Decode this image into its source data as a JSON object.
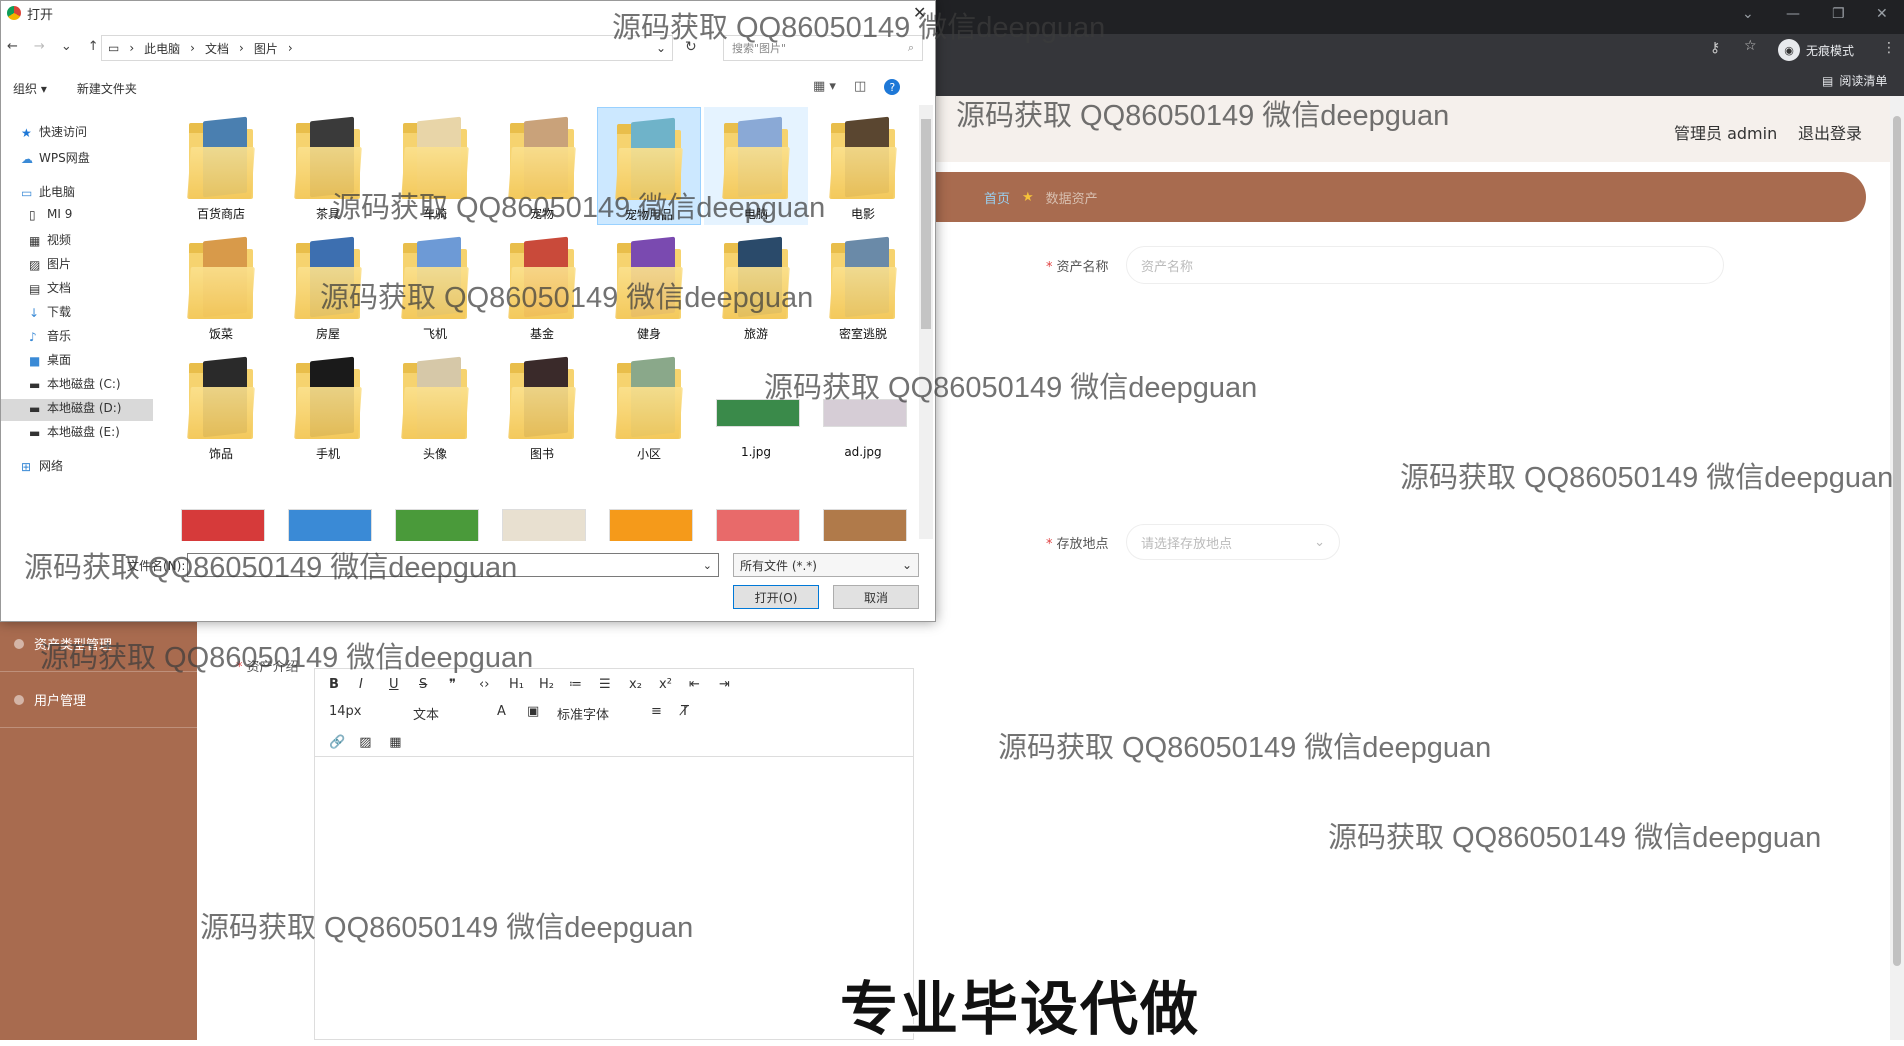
{
  "browser": {
    "profile_label": "无痕模式",
    "reading_list": "阅读清单"
  },
  "app": {
    "admin_label": "管理员 admin",
    "logout_label": "退出登录",
    "breadcrumb": {
      "home": "首页",
      "current": "数据资产"
    },
    "sidebar": {
      "items": [
        {
          "label": "资产类型管理"
        },
        {
          "label": "用户管理"
        }
      ]
    },
    "form": {
      "name_label": "资产名称",
      "name_placeholder": "资产名称",
      "location_label": "存放地点",
      "location_placeholder": "请选择存放地点",
      "intro_label": "资产介绍"
    },
    "editor": {
      "font_size": "14px",
      "text_type": "文本",
      "font_family": "标准字体"
    }
  },
  "dialog": {
    "title": "打开",
    "address": [
      "此电脑",
      "文档",
      "图片"
    ],
    "search_placeholder": "搜索\"图片\"",
    "organize_label": "组织 ▾",
    "new_folder_label": "新建文件夹",
    "nav": [
      {
        "label": "快速访问",
        "icon": "star-icon"
      },
      {
        "label": "WPS网盘",
        "icon": "cloud-icon"
      },
      {
        "label": "此电脑",
        "icon": "computer-icon"
      },
      {
        "label": "MI 9",
        "icon": "phone-icon"
      },
      {
        "label": "视频",
        "icon": "video-icon"
      },
      {
        "label": "图片",
        "icon": "picture-icon"
      },
      {
        "label": "文档",
        "icon": "document-icon"
      },
      {
        "label": "下载",
        "icon": "download-icon"
      },
      {
        "label": "音乐",
        "icon": "music-icon"
      },
      {
        "label": "桌面",
        "icon": "desktop-icon"
      },
      {
        "label": "本地磁盘 (C:)",
        "icon": "disk-icon"
      },
      {
        "label": "本地磁盘 (D:)",
        "icon": "disk-icon"
      },
      {
        "label": "本地磁盘 (E:)",
        "icon": "disk-icon"
      },
      {
        "label": "网络",
        "icon": "network-icon"
      }
    ],
    "files": [
      {
        "name": "百货商店",
        "kind": "folder",
        "color": "#4a7fb0"
      },
      {
        "name": "茶具",
        "kind": "folder",
        "color": "#3a3a3a"
      },
      {
        "name": "车骑",
        "kind": "folder",
        "color": "#e8d5a8"
      },
      {
        "name": "宠物",
        "kind": "folder",
        "color": "#c9a27a"
      },
      {
        "name": "宠物用品",
        "kind": "folder",
        "color": "#6fb3c9"
      },
      {
        "name": "电脑",
        "kind": "folder",
        "color": "#8aa9d6"
      },
      {
        "name": "电影",
        "kind": "folder",
        "color": "#5a4630"
      },
      {
        "name": "饭菜",
        "kind": "folder",
        "color": "#d89a4a"
      },
      {
        "name": "房屋",
        "kind": "folder",
        "color": "#3d6fb0"
      },
      {
        "name": "飞机",
        "kind": "folder",
        "color": "#6d9ad6"
      },
      {
        "name": "基金",
        "kind": "folder",
        "color": "#c94a3a"
      },
      {
        "name": "健身",
        "kind": "folder",
        "color": "#7a4ab0"
      },
      {
        "name": "旅游",
        "kind": "folder",
        "color": "#2a4a6a"
      },
      {
        "name": "密室逃脱",
        "kind": "folder",
        "color": "#6a8aa8"
      },
      {
        "name": "饰品",
        "kind": "folder",
        "color": "#2a2a2a"
      },
      {
        "name": "手机",
        "kind": "folder",
        "color": "#1a1a1a"
      },
      {
        "name": "头像",
        "kind": "folder",
        "color": "#d6c8a8"
      },
      {
        "name": "图书",
        "kind": "folder",
        "color": "#3a2a2a"
      },
      {
        "name": "小区",
        "kind": "folder",
        "color": "#8aa88a"
      },
      {
        "name": "1.jpg",
        "kind": "image",
        "color": "#3a8a4a"
      },
      {
        "name": "ad.jpg",
        "kind": "image",
        "color": "#d6cdd6"
      },
      {
        "name": "",
        "kind": "image",
        "color": "#d63a3a"
      },
      {
        "name": "",
        "kind": "image",
        "color": "#3a8ad6"
      },
      {
        "name": "",
        "kind": "image",
        "color": "#4a9a3a"
      },
      {
        "name": "",
        "kind": "image",
        "color": "#e8e0d0"
      },
      {
        "name": "",
        "kind": "image",
        "color": "#f59a1a"
      },
      {
        "name": "",
        "kind": "image",
        "color": "#e86a6a"
      },
      {
        "name": "",
        "kind": "image",
        "color": "#b07a4a"
      }
    ],
    "filename_label": "文件名(N):",
    "filename_value": "",
    "filter_value": "所有文件 (*.*)",
    "open_label": "打开(O)",
    "cancel_label": "取消"
  },
  "watermark": "源码获取 QQ86050149 微信deepguan",
  "banner": "专业毕设代做"
}
